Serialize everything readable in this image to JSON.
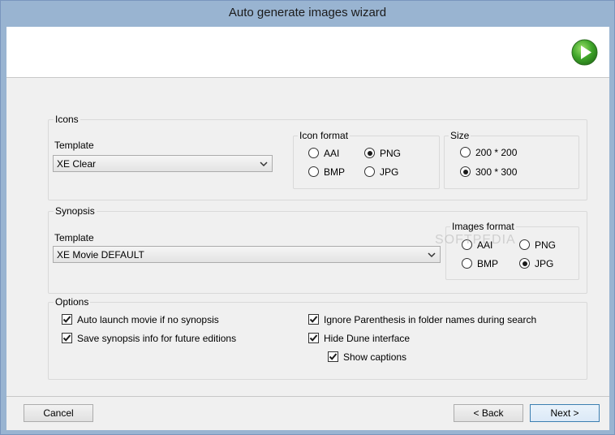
{
  "window": {
    "title": "Auto generate images wizard"
  },
  "icons_group": {
    "legend": "Icons",
    "template_label": "Template",
    "template_value": "XE Clear",
    "icon_format": {
      "legend": "Icon format",
      "options": [
        "AAI",
        "PNG",
        "BMP",
        "JPG"
      ],
      "selected": "PNG"
    },
    "size": {
      "legend": "Size",
      "options": [
        "200 * 200",
        "300 * 300"
      ],
      "selected": "300 * 300"
    }
  },
  "synopsis_group": {
    "legend": "Synopsis",
    "template_label": "Template",
    "template_value": "XE Movie DEFAULT",
    "images_format": {
      "legend": "Images format",
      "options": [
        "AAI",
        "PNG",
        "BMP",
        "JPG"
      ],
      "selected": "JPG"
    }
  },
  "options_group": {
    "legend": "Options",
    "auto_launch": "Auto launch movie if no synopsis",
    "save_synopsis": "Save synopsis info for future editions",
    "ignore_parenthesis": "Ignore Parenthesis in folder names during search",
    "hide_dune": "Hide Dune interface",
    "show_captions": "Show captions"
  },
  "buttons": {
    "cancel": "Cancel",
    "back": "< Back",
    "next": "Next >"
  },
  "watermark": "SOFTPEDIA"
}
